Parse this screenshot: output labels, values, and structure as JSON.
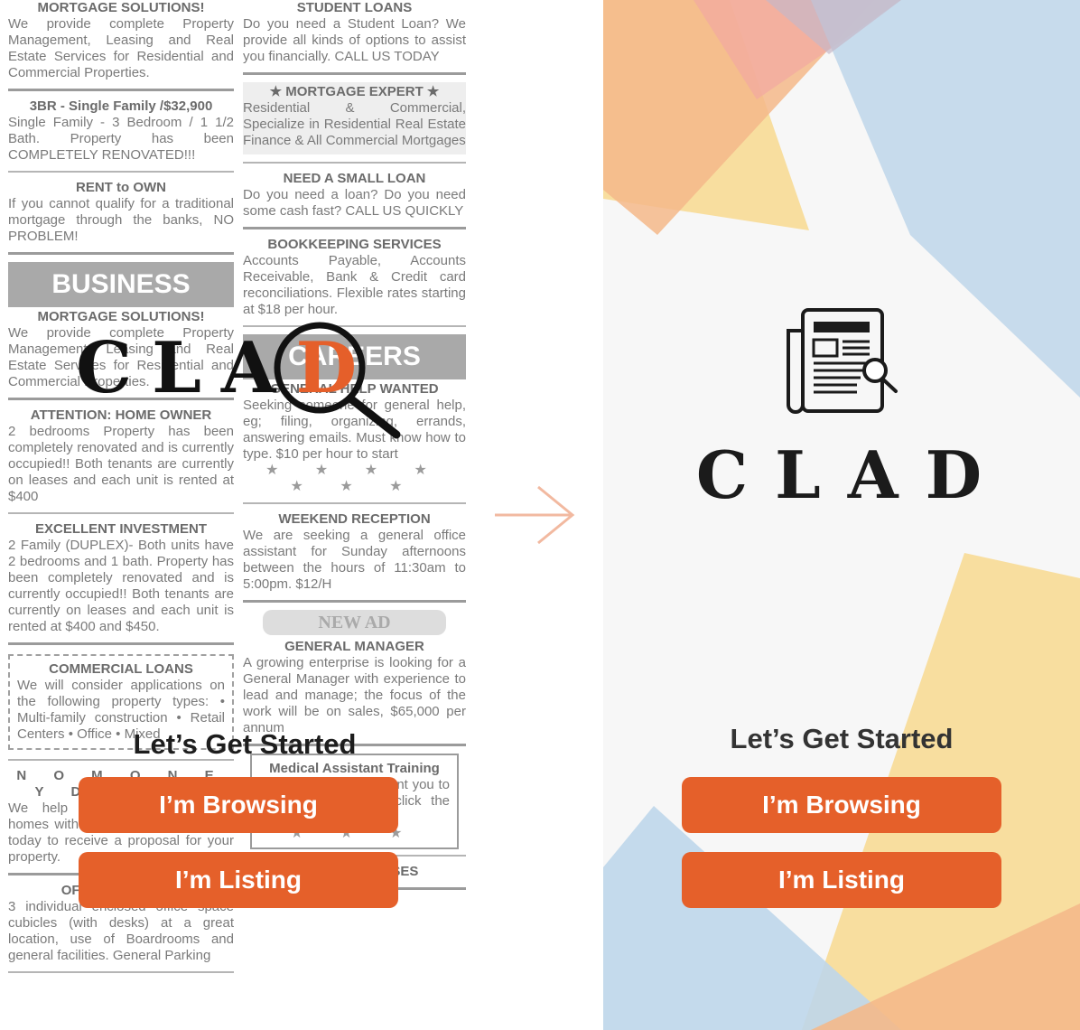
{
  "screen_a": {
    "left_column": [
      {
        "heading": "MORTGAGE SOLUTIONS!",
        "body": "We provide complete Property Management, Leasing and Real Estate Services for Residential and Commercial Properties."
      },
      {
        "heading": "3BR - Single Family /$32,900",
        "body": "Single Family - 3 Bedroom / 1 1/2 Bath. Property has been COMPLETELY RENOVATED!!!"
      },
      {
        "heading": "RENT to OWN",
        "body": "If you cannot qualify for a traditional mortgage through the banks, NO PROBLEM!"
      },
      {
        "band": "BUSINESS"
      },
      {
        "heading": "MORTGAGE SOLUTIONS!",
        "body": "We provide complete Property Management, Leasing and Real Estate Services for Residential and Commercial Properties."
      },
      {
        "heading": "ATTENTION: HOME OWNER",
        "body": "2 bedrooms Property has been completely renovated and is currently occupied!! Both tenants are currently on leases and each unit is rented at $400"
      },
      {
        "heading": "EXCELLENT INVESTMENT",
        "body": "2 Family (DUPLEX)- Both units have 2 bedrooms and 1 bath. Property has been completely renovated and is currently occupied!! Both tenants are currently on leases and each unit is rented at $400 and $450."
      },
      {
        "heading": "COMMERCIAL LOANS",
        "body": "We will consider applications on the following property types: • Multi-family construction • Retail Centers • Office • Mixed",
        "dashed": true
      },
      {
        "heading": "N O   M O N E Y   D O W N",
        "body": "We help homeowners sell their homes with no money down, call us today to receive a proposal for your property.",
        "spread": true
      },
      {
        "heading": "OFFICE AVILABLE",
        "body": "3 individual enclosed office space cubicles (with desks) at a great location, use of Boardrooms and general facilities. General Parking"
      }
    ],
    "right_column": [
      {
        "heading": "STUDENT LOANS",
        "body": "Do you need a Student Loan? We provide all kinds of options to assist you financially. CALL US TODAY"
      },
      {
        "heading": "★ MORTGAGE EXPERT ★",
        "body": "Residential & Commercial, Specialize in Residential Real Estate Finance & All Commercial Mortgages",
        "boxed": true
      },
      {
        "heading": "NEED A SMALL LOAN",
        "body": "Do you need a loan? Do you need some cash fast? CALL US QUICKLY"
      },
      {
        "heading": "BOOKKEEPING SERVICES",
        "body": "Accounts Payable, Accounts Receivable, Bank & Credit card reconciliations. Flexible rates starting at $18 per hour."
      },
      {
        "band": "CAREERS"
      },
      {
        "heading": "GENERAL HELP WANTED",
        "body": "Seeking someone for general help, eg; filing, organizing, errands, answering emails. Must know how to type. $10 per hour to start",
        "stars": "★ ★ ★ ★ ★ ★ ★"
      },
      {
        "heading": "WEEKEND RECEPTION",
        "body": "We are seeking a general office assistant for Sunday afternoons between the hours of 11:30am to 5:00pm. $12/H"
      },
      {
        "pill": "NEW AD"
      },
      {
        "heading": "GENERAL MANAGER",
        "body": "A growing enterprise is looking for a General Manager with experience to lead and manage; the focus of the work will be on sales, $65,000 per annum"
      },
      {
        "heading": "Medical Assistant Training",
        "body": "Online Classes We want you to be successful. Just click the link and learn today.",
        "stars": "★ ★ ★",
        "framed": true
      },
      {
        "heading": "ENGLISH CLASSES",
        "body": ""
      }
    ],
    "logo_text": "CLA",
    "logo_accent_letter": "D",
    "title": "Let’s Get Started",
    "browse_label": "I’m Browsing",
    "list_label": "I’m Listing"
  },
  "screen_b": {
    "brand": "CLAD",
    "title": "Let’s Get Started",
    "browse_label": "I’m Browsing",
    "list_label": "I’m Listing"
  },
  "colors": {
    "accent": "#e5602a",
    "arrow": "#f2b9a0",
    "shape_peach": "#f4b98a",
    "shape_blue": "#bed6ea",
    "shape_yellow": "#f8d98f",
    "shape_pink": "#f2a9a0"
  },
  "icons": [
    "newspaper-search-icon",
    "magnifier-icon",
    "arrow-right-icon"
  ]
}
